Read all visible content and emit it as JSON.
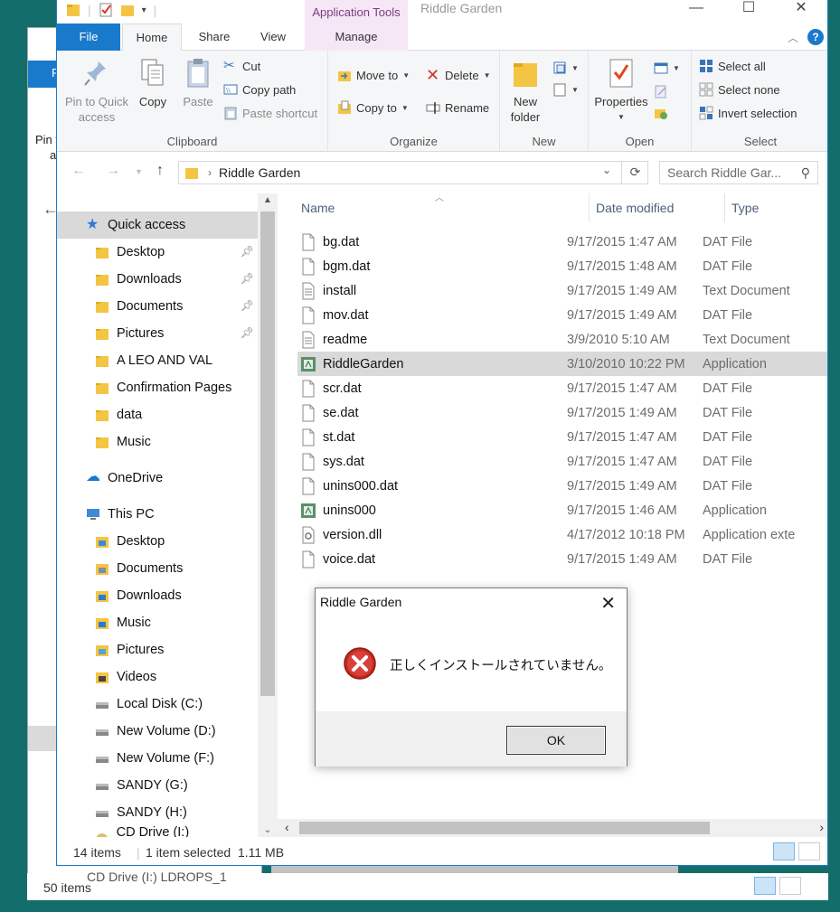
{
  "background_window": {
    "title_fragment": "F",
    "nav_fragment": "Pin t",
    "nav_fragment2": "a",
    "status": "50 items",
    "cd_text": "CD Drive (I:) LDROPS_1"
  },
  "window": {
    "title": "Riddle Garden",
    "app_tools_label": "Application Tools",
    "controls": {
      "minimize": "—",
      "maximize": "☐",
      "close": "✕"
    }
  },
  "tabs": {
    "file": "File",
    "home": "Home",
    "share": "Share",
    "view": "View",
    "manage": "Manage"
  },
  "ribbon": {
    "clipboard": {
      "label": "Clipboard",
      "pin_label": "Pin to Quick access",
      "copy": "Copy",
      "paste": "Paste",
      "cut": "Cut",
      "copy_path": "Copy path",
      "paste_shortcut": "Paste shortcut"
    },
    "organize": {
      "label": "Organize",
      "move_to": "Move to",
      "copy_to": "Copy to",
      "delete": "Delete",
      "rename": "Rename"
    },
    "new": {
      "label": "New",
      "new_folder": "New folder"
    },
    "open": {
      "label": "Open",
      "properties": "Properties"
    },
    "select": {
      "label": "Select",
      "select_all": "Select all",
      "select_none": "Select none",
      "invert": "Invert selection"
    }
  },
  "address": {
    "path": "Riddle Garden",
    "search_placeholder": "Search Riddle Gar..."
  },
  "nav": {
    "quick_access": "Quick access",
    "qa_items": [
      {
        "label": "Desktop",
        "pinned": true
      },
      {
        "label": "Downloads",
        "pinned": true
      },
      {
        "label": "Documents",
        "pinned": true
      },
      {
        "label": "Pictures",
        "pinned": true
      },
      {
        "label": "A LEO AND VAL",
        "pinned": false
      },
      {
        "label": "Confirmation Pages",
        "pinned": false
      },
      {
        "label": "data",
        "pinned": false
      },
      {
        "label": "Music",
        "pinned": false
      }
    ],
    "onedrive": "OneDrive",
    "this_pc": "This PC",
    "pc_items": [
      "Desktop",
      "Documents",
      "Downloads",
      "Music",
      "Pictures",
      "Videos",
      "Local Disk (C:)",
      "New Volume (D:)",
      "New Volume (F:)",
      "SANDY (G:)",
      "SANDY (H:)",
      "CD Drive (I:) LDROPS_1"
    ]
  },
  "columns": {
    "name": "Name",
    "date": "Date modified",
    "type": "Type"
  },
  "files": [
    {
      "name": "bg.dat",
      "date": "9/17/2015 1:47 AM",
      "type": "DAT File",
      "icon": "blank"
    },
    {
      "name": "bgm.dat",
      "date": "9/17/2015 1:48 AM",
      "type": "DAT File",
      "icon": "blank"
    },
    {
      "name": "install",
      "date": "9/17/2015 1:49 AM",
      "type": "Text Document",
      "icon": "text"
    },
    {
      "name": "mov.dat",
      "date": "9/17/2015 1:49 AM",
      "type": "DAT File",
      "icon": "blank"
    },
    {
      "name": "readme",
      "date": "3/9/2010 5:10 AM",
      "type": "Text Document",
      "icon": "text"
    },
    {
      "name": "RiddleGarden",
      "date": "3/10/2010 10:22 PM",
      "type": "Application",
      "icon": "app",
      "selected": true
    },
    {
      "name": "scr.dat",
      "date": "9/17/2015 1:47 AM",
      "type": "DAT File",
      "icon": "blank"
    },
    {
      "name": "se.dat",
      "date": "9/17/2015 1:49 AM",
      "type": "DAT File",
      "icon": "blank"
    },
    {
      "name": "st.dat",
      "date": "9/17/2015 1:47 AM",
      "type": "DAT File",
      "icon": "blank"
    },
    {
      "name": "sys.dat",
      "date": "9/17/2015 1:47 AM",
      "type": "DAT File",
      "icon": "blank"
    },
    {
      "name": "unins000.dat",
      "date": "9/17/2015 1:49 AM",
      "type": "DAT File",
      "icon": "blank"
    },
    {
      "name": "unins000",
      "date": "9/17/2015 1:46 AM",
      "type": "Application",
      "icon": "app"
    },
    {
      "name": "version.dll",
      "date": "4/17/2012 10:18 PM",
      "type": "Application exte",
      "icon": "dll"
    },
    {
      "name": "voice.dat",
      "date": "9/17/2015 1:49 AM",
      "type": "DAT File",
      "icon": "blank"
    }
  ],
  "status": {
    "count": "14 items",
    "selected": "1 item selected  1.11 MB"
  },
  "dialog": {
    "title": "Riddle Garden",
    "message": "正しくインストールされていません。",
    "ok": "OK",
    "close": "✕"
  },
  "colors": {
    "accent": "#1979ca",
    "app_tools": "#f5e7f6",
    "selection": "#d9d9d9",
    "desktop": "#136e6b",
    "error": "#c42b1c"
  }
}
